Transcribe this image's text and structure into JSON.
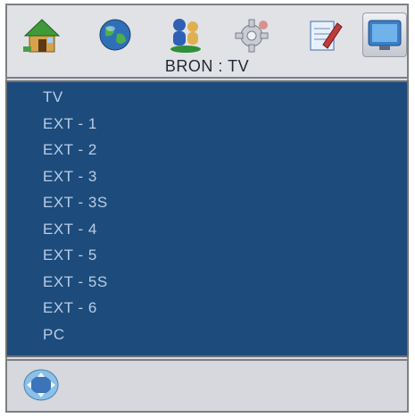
{
  "menu": {
    "icons": [
      {
        "name": "home-icon"
      },
      {
        "name": "globe-icon"
      },
      {
        "name": "users-icon"
      },
      {
        "name": "gear-icon"
      },
      {
        "name": "edit-icon"
      },
      {
        "name": "monitor-icon",
        "selected": true
      }
    ],
    "title": "BRON : TV"
  },
  "sources": {
    "items": [
      "TV",
      "EXT - 1",
      "EXT - 2",
      "EXT - 3",
      "EXT - 3S",
      "EXT - 4",
      "EXT - 5",
      "EXT - 5S",
      "EXT - 6",
      "PC"
    ]
  },
  "footer": {
    "icon": "nav-dpad-icon"
  },
  "colors": {
    "panel": "#1d4b7c",
    "item_text": "#b9cde6",
    "bar": "#e1e2e6"
  }
}
